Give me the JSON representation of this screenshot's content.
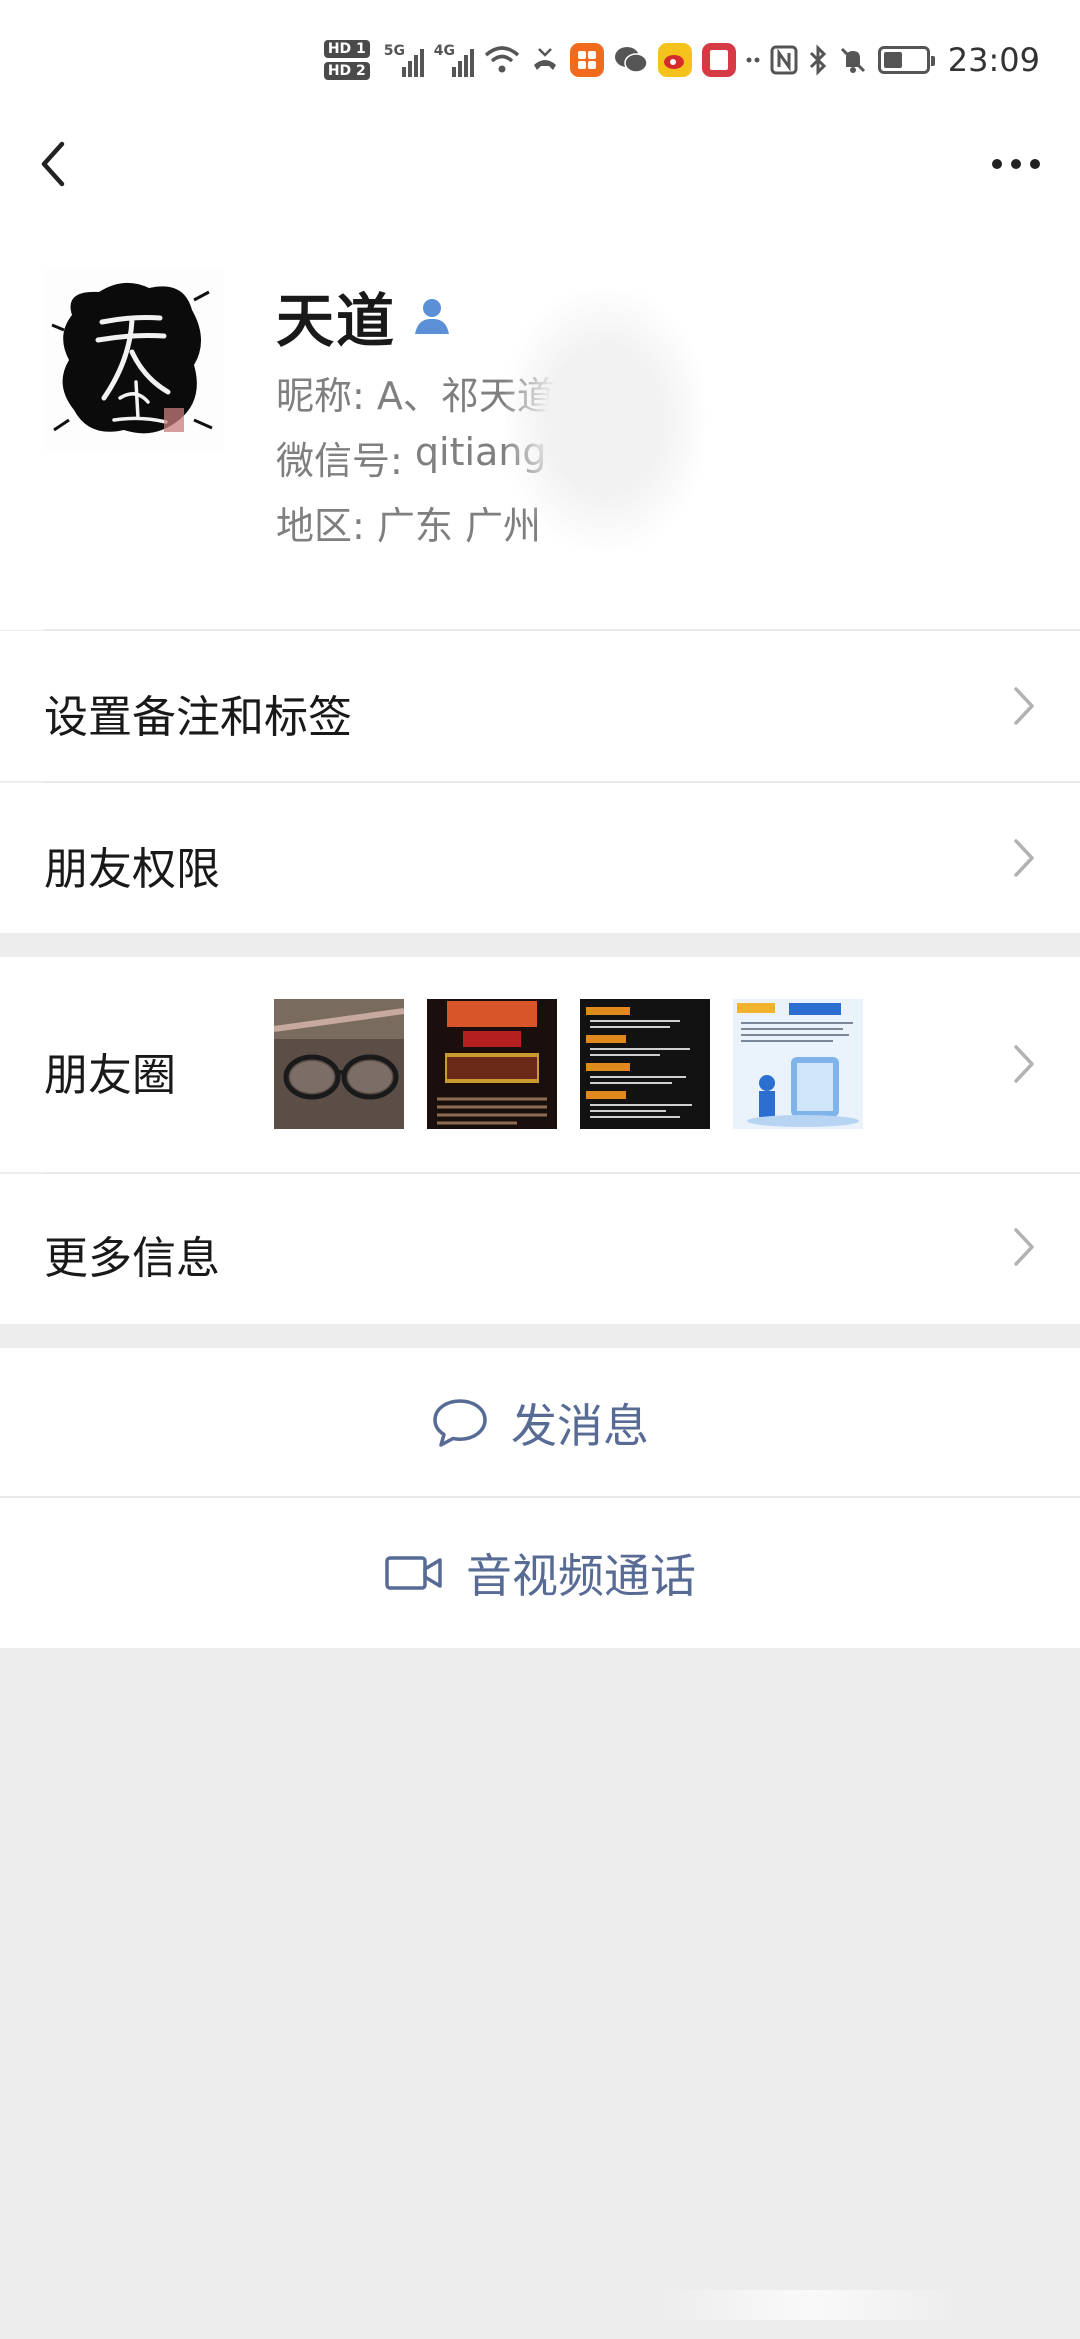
{
  "status_bar": {
    "hd1": "HD 1",
    "hd2": "HD 2",
    "net1": "5G",
    "net2": "4G",
    "time": "23:09",
    "icons": [
      "hd-icon",
      "signal-5g-icon",
      "signal-4g-icon",
      "wifi-icon",
      "missed-call-icon",
      "app-icon-orange",
      "wechat-icon",
      "weibo-icon",
      "app-icon-red",
      "nfc-icon",
      "bluetooth-icon",
      "mute-icon",
      "battery-icon"
    ],
    "battery_level": 0.45
  },
  "nav": {
    "back_icon": "chevron-left-icon",
    "more_icon": "more-dots-icon"
  },
  "profile": {
    "name": "天道",
    "verified_icon": "person-icon",
    "nickname_label": "昵称:",
    "nickname_value": "A、祁天道",
    "wechat_id_label": "微信号:",
    "wechat_id_value": "qitiang",
    "region_label": "地区:",
    "region_value": "广东  广州"
  },
  "cells": {
    "remark_tags": "设置备注和标签",
    "friend_permissions": "朋友权限",
    "moments": "朋友圈",
    "more_info": "更多信息"
  },
  "moments_thumbs": [
    "glasses-photo",
    "promo-poster",
    "text-list-poster",
    "health-poster"
  ],
  "actions": {
    "send_message": "发消息",
    "video_call": "音视频通话"
  },
  "colors": {
    "link": "#576b95",
    "background": "#ededed",
    "card": "#ffffff",
    "verified": "#5b8fd6"
  }
}
